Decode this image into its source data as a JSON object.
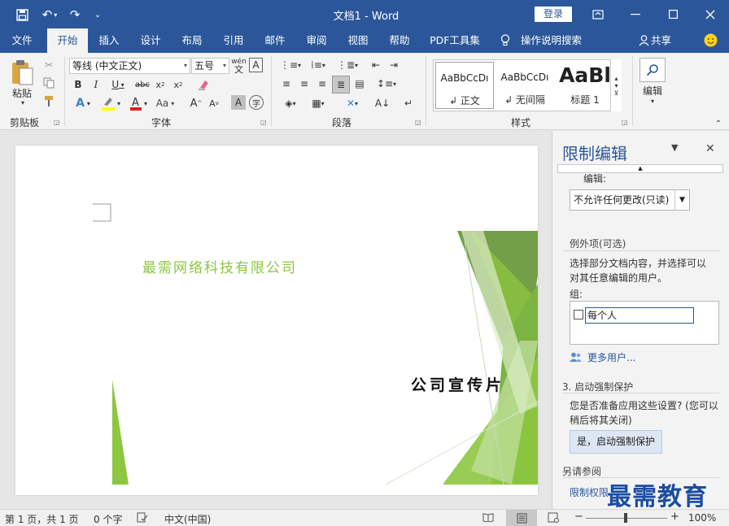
{
  "titlebar": {
    "doc_title": "文档1 - Word",
    "login_label": "登录",
    "bg_color": "#2b579a"
  },
  "tabs": [
    {
      "label": "文件"
    },
    {
      "label": "开始"
    },
    {
      "label": "插入"
    },
    {
      "label": "设计"
    },
    {
      "label": "布局"
    },
    {
      "label": "引用"
    },
    {
      "label": "邮件"
    },
    {
      "label": "审阅"
    },
    {
      "label": "视图"
    },
    {
      "label": "帮助"
    },
    {
      "label": "PDF工具集"
    }
  ],
  "tell_me": "操作说明搜索",
  "share_label": "共享",
  "clipboard": {
    "paste_label": "粘贴",
    "group_label": "剪贴板"
  },
  "font": {
    "name": "等线 (中文正文)",
    "size": "五号",
    "group_label": "字体",
    "wen_label": "wén",
    "wen_char": "文",
    "a_label": "A"
  },
  "paragraph": {
    "group_label": "段落"
  },
  "styles": {
    "group_label": "样式",
    "items": [
      {
        "sample": "AaBbCcDı",
        "name": "↲ 正文"
      },
      {
        "sample": "AaBbCcDı",
        "name": "↲ 无间隔"
      },
      {
        "sample": "AaBl",
        "name": "标题 1"
      }
    ]
  },
  "editing": {
    "label": "编辑"
  },
  "document": {
    "company": "最需网络科技有限公司",
    "promo": "公司宣传片",
    "accent_color": "#8dc63f"
  },
  "pane": {
    "title": "限制编辑",
    "edit_label": "编辑:",
    "edit_select": "不允许任何更改(只读)",
    "exceptions_head": "例外项(可选)",
    "exceptions_text_1": "选择部分文档内容，并选择可以",
    "exceptions_text_2": "对其任意编辑的用户。",
    "groups_label": "组:",
    "group_everyone": "每个人",
    "more_users": "更多用户...",
    "step3_head": "3. 启动强制保护",
    "step3_text_1": "您是否准备应用这些设置? (您可以",
    "step3_text_2": "稍后将其关闭)",
    "enforce_button": "是，启动强制保护",
    "see_also_head": "另请参阅",
    "restrict_link": "限制权限"
  },
  "watermark": "最需教育",
  "status": {
    "page": "第 1 页，共 1 页",
    "words": "0 个字",
    "lang": "中文(中国)",
    "zoom": "100%"
  }
}
